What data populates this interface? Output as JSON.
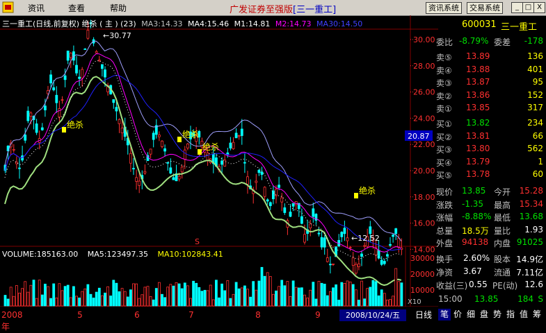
{
  "menubar": {
    "items": [
      "资讯",
      "查看",
      "帮助"
    ],
    "title_prefix": "广发证券至强版",
    "title_stock": "[三一重工]",
    "btn_info": "资讯系统",
    "btn_trade": "交易系统",
    "win_min": "_",
    "win_max": "□",
    "win_close": "X"
  },
  "chart_header": {
    "name": "三一重工(日线,前复权) 绝杀 ( 主 ) (23)",
    "ma3": "MA3:14.33",
    "ma4": "MA4:15.46",
    "m1": "M1:14.81",
    "m2": "M2:14.73",
    "m30": "MA30:14.50"
  },
  "volume_header": {
    "volume": "VOLUME:185163.00",
    "ma5": "MA5:123497.35",
    "ma10": "MA10:102843.41"
  },
  "price_axis": [
    "30.00",
    "28.00",
    "26.00",
    "24.00",
    "22.00",
    "20.00",
    "18.00",
    "16.00",
    "14.00"
  ],
  "price_marker": "20.87",
  "volume_axis": [
    "30000",
    "20000",
    "10000"
  ],
  "volume_unit": "X10",
  "annotations": {
    "high": "30.77",
    "low": "12.52",
    "signal": "绝杀",
    "s_mark": "S"
  },
  "time_axis": {
    "labels": [
      "2008年",
      "5",
      "6",
      "7",
      "8",
      "9"
    ],
    "current": "2008/10/24/五",
    "period": "日线"
  },
  "quote": {
    "code": "600031",
    "name": "三一重工",
    "weibi_label": "委比",
    "weibi": "-8.79%",
    "weicha_label": "委差",
    "weicha": "-178",
    "sells": [
      {
        "label": "卖⑤",
        "price": "13.89",
        "vol": "136"
      },
      {
        "label": "卖④",
        "price": "13.88",
        "vol": "401"
      },
      {
        "label": "卖③",
        "price": "13.87",
        "vol": "95"
      },
      {
        "label": "卖②",
        "price": "13.86",
        "vol": "152"
      },
      {
        "label": "卖①",
        "price": "13.85",
        "vol": "317"
      }
    ],
    "buys": [
      {
        "label": "买①",
        "price": "13.82",
        "vol": "234"
      },
      {
        "label": "买②",
        "price": "13.81",
        "vol": "66"
      },
      {
        "label": "买③",
        "price": "13.80",
        "vol": "562"
      },
      {
        "label": "买④",
        "price": "13.79",
        "vol": "1"
      },
      {
        "label": "买⑤",
        "price": "13.78",
        "vol": "60"
      }
    ],
    "stats": [
      {
        "l1": "现价",
        "v1": "13.85",
        "c1": "green",
        "l2": "今开",
        "v2": "15.28",
        "c2": "red"
      },
      {
        "l1": "涨跌",
        "v1": "-1.35",
        "c1": "green",
        "l2": "最高",
        "v2": "15.34",
        "c2": "red"
      },
      {
        "l1": "涨幅",
        "v1": "-8.88%",
        "c1": "green",
        "l2": "最低",
        "v2": "13.68",
        "c2": "green"
      },
      {
        "l1": "总量",
        "v1": "18.5万",
        "c1": "yellow",
        "l2": "量比",
        "v2": "1.93",
        "c2": "white"
      },
      {
        "l1": "外盘",
        "v1": "94138",
        "c1": "red",
        "l2": "内盘",
        "v2": "91025",
        "c2": "green"
      }
    ],
    "stats2": [
      {
        "l1": "换手",
        "v1": "2.60%",
        "l2": "股本",
        "v2": "14.9亿"
      },
      {
        "l1": "净资",
        "v1": "3.67",
        "l2": "流通",
        "v2": "7.11亿"
      },
      {
        "l1": "收益(三)",
        "v1": "0.55",
        "l2": "PE(动)",
        "v2": "12.6"
      }
    ],
    "tick": {
      "time": "15:00",
      "price": "13.85",
      "vol": "184",
      "side": "S"
    }
  },
  "bottom_tabs": [
    "笔",
    "价",
    "细",
    "盘",
    "势",
    "指",
    "值",
    "筹"
  ],
  "colors": {
    "up": "#ff3030",
    "down": "#00ffff",
    "ma_white": "#ffffff",
    "accent": "#ffff00"
  }
}
